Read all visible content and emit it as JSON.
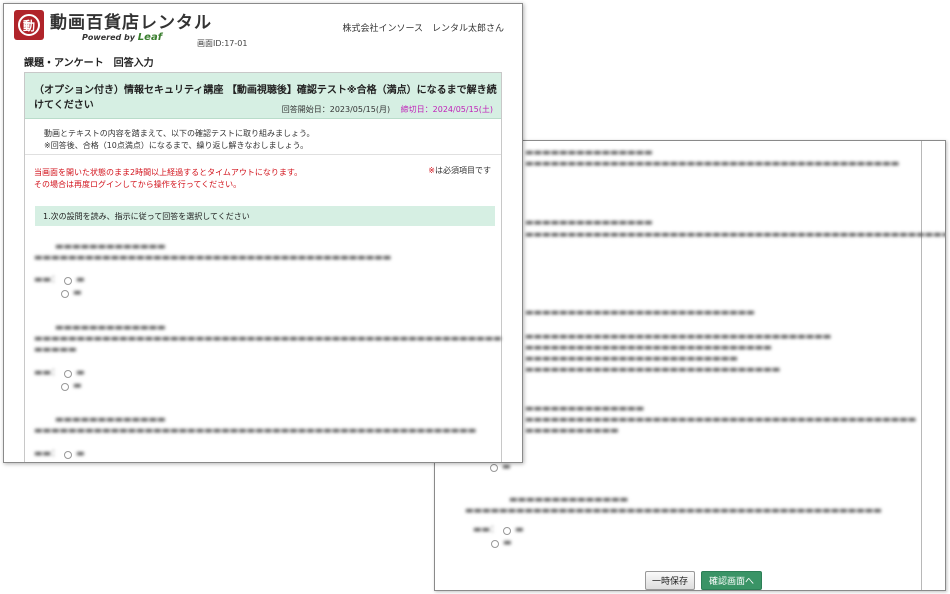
{
  "header": {
    "brand_name": "動画百貨店レンタル",
    "powered_by": "Powered by",
    "powered_brand": "Leaf",
    "logo_glyph": "動",
    "screen_id": "画面ID:17-01",
    "company_user": "株式会社インソース　レンタル太郎さん"
  },
  "page_title": "課題・アンケート　回答入力",
  "course": {
    "title": "（オプション付き）情報セキュリティ講座 【動画視聴後】確認テスト※合格（満点）になるまで解き続けてください",
    "start_label": "回答開始日：2023/05/15(月)",
    "deadline_label": "締切日：2024/05/15(土)"
  },
  "intro": {
    "line1": "動画とテキストの内容を踏まえて、以下の確認テストに取り組みましょう。",
    "line2": "※回答後、合格（10点満点）になるまで、繰り返し解きなおしましょう。"
  },
  "warning": {
    "line1": "当画面を開いた状態のまま2時間以上経過するとタイムアウトになります。",
    "line2": "その場合は再度ログインしてから操作を行ってください。"
  },
  "required_note": {
    "asterisk": "※",
    "text": "は必須項目です"
  },
  "question_instruction": "1.次の設問を読み、指示に従って回答を選択してください",
  "buttons": {
    "save": "一時保存",
    "confirm": "確認画面へ"
  },
  "colors": {
    "brand_red": "#b0242a",
    "header_green": "#d6efe3",
    "confirm_green": "#3a9466",
    "warning_red": "#d2121b",
    "deadline_magenta": "#c020b8"
  }
}
